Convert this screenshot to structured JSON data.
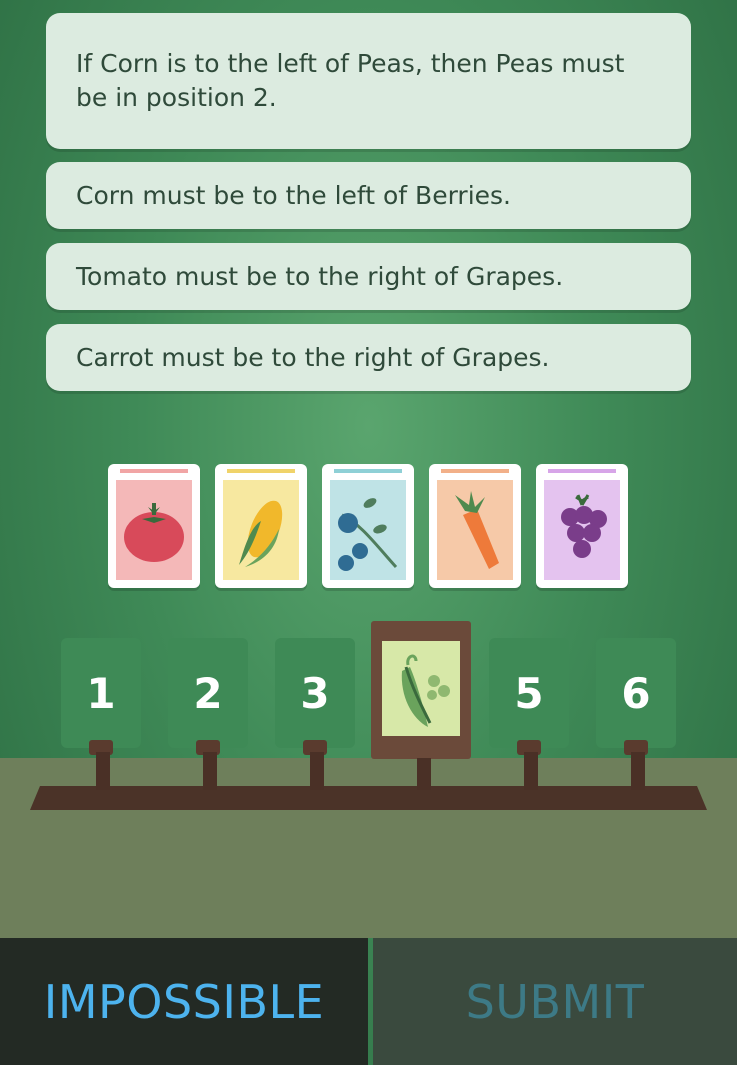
{
  "clues": [
    "If Corn is to the left of Peas, then Peas must be in position 2.",
    "Corn must be to the left of Berries.",
    "Tomato must be to the right of Grapes.",
    "Carrot must be to the right of Grapes."
  ],
  "packets": [
    {
      "name": "tomato",
      "icon": "tomato-icon",
      "bg": "#f4b8b8",
      "strip": "#f1a5a5"
    },
    {
      "name": "corn",
      "icon": "corn-icon",
      "bg": "#f7e8a0",
      "strip": "#f0d36a"
    },
    {
      "name": "berries",
      "icon": "berries-icon",
      "bg": "#bfe3e6",
      "strip": "#8fd0d6"
    },
    {
      "name": "carrot",
      "icon": "carrot-icon",
      "bg": "#f6c9a8",
      "strip": "#f2b089"
    },
    {
      "name": "grapes",
      "icon": "grapes-icon",
      "bg": "#e4c3ef",
      "strip": "#d7a5e8"
    }
  ],
  "slots": {
    "labels": [
      "1",
      "2",
      "3",
      "5",
      "6"
    ],
    "placed": {
      "position": "4",
      "item": "peas",
      "icon": "peas-icon"
    }
  },
  "buttons": {
    "impossible": "IMPOSSIBLE",
    "submit": "SUBMIT"
  },
  "colors": {
    "impossible_text": "#4db3ee",
    "submit_text": "#3d7a86",
    "impossible_bg": "#232a24",
    "submit_bg": "#3a4a3e"
  }
}
